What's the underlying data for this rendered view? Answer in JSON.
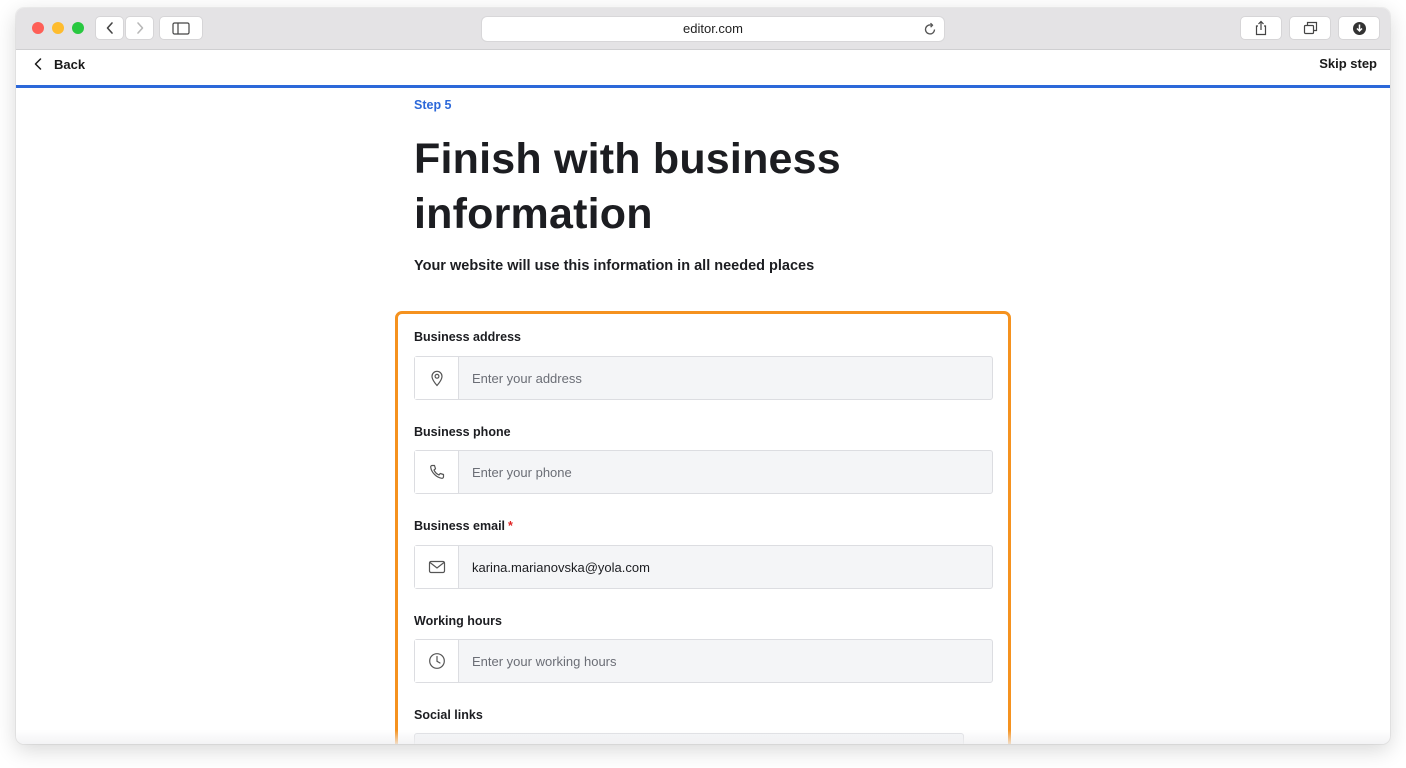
{
  "browser": {
    "url": "editor.com"
  },
  "nav": {
    "back_label": "Back",
    "skip_label": "Skip step"
  },
  "wizard": {
    "step_label": "Step 5",
    "title": "Finish with business information",
    "subtitle": "Your website will use this information in all needed places",
    "progress_percent": 100
  },
  "form": {
    "address": {
      "label": "Business address",
      "placeholder": "Enter your address",
      "value": "",
      "icon": "location-pin-icon"
    },
    "phone": {
      "label": "Business phone",
      "placeholder": "Enter your phone",
      "value": "",
      "icon": "phone-icon"
    },
    "email": {
      "label": "Business email",
      "required_mark": "*",
      "placeholder": "",
      "value": "karina.marianovska@yola.com",
      "icon": "envelope-icon"
    },
    "hours": {
      "label": "Working hours",
      "placeholder": "Enter your working hours",
      "value": "",
      "icon": "clock-icon"
    },
    "social": {
      "label": "Social links"
    }
  },
  "colors": {
    "accent": "#2c68d9",
    "highlight_border": "#f5921f",
    "required": "#e02424"
  }
}
